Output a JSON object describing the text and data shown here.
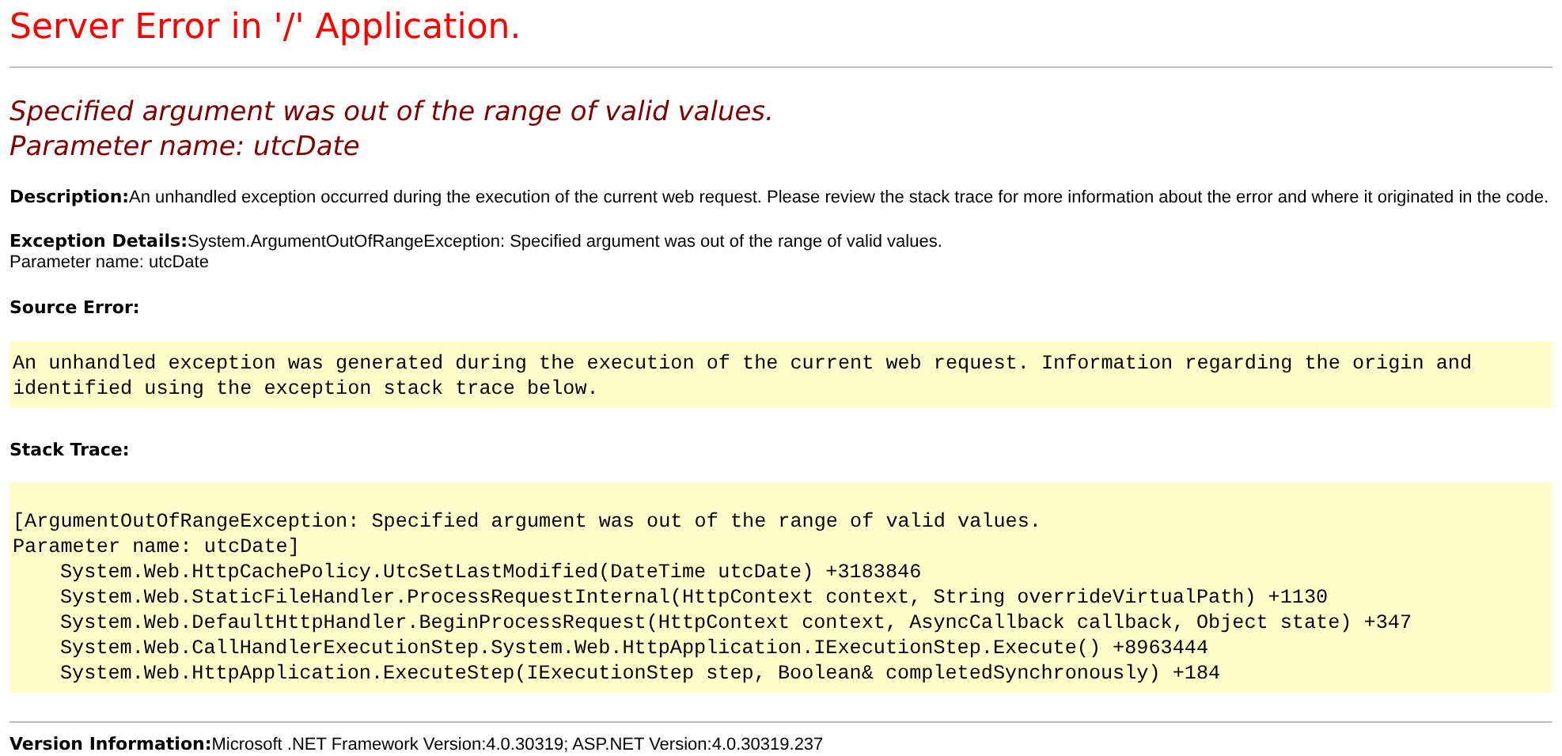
{
  "title": "Server Error in '/' Application.",
  "error_heading": [
    "Specified argument was out of the range of valid values.",
    "Parameter name: utcDate"
  ],
  "description": {
    "label": "Description:",
    "text": "An unhandled exception occurred during the execution of the current web request. Please review the stack trace for more information about the error and where it originated in the code."
  },
  "exception_details": {
    "label": "Exception Details:",
    "text": "System.ArgumentOutOfRangeException: Specified argument was out of the range of valid values.",
    "extra": "Parameter name: utcDate"
  },
  "source_error": {
    "label": "Source Error:",
    "text": "An unhandled exception was generated during the execution of the current web request. Information regarding the origin and identified using the exception stack trace below."
  },
  "stack_trace": {
    "label": "Stack Trace:",
    "lines": [
      {
        "kind": "message",
        "text": "[ArgumentOutOfRangeException: Specified argument was out of the range of valid values."
      },
      {
        "kind": "message",
        "text": "Parameter name: utcDate]"
      },
      {
        "kind": "frame",
        "text": "System.Web.HttpCachePolicy.UtcSetLastModified(DateTime utcDate) +3183846"
      },
      {
        "kind": "frame",
        "text": "System.Web.StaticFileHandler.ProcessRequestInternal(HttpContext context, String overrideVirtualPath) +1130"
      },
      {
        "kind": "frame",
        "text": "System.Web.DefaultHttpHandler.BeginProcessRequest(HttpContext context, AsyncCallback callback, Object state) +347"
      },
      {
        "kind": "frame",
        "text": "System.Web.CallHandlerExecutionStep.System.Web.HttpApplication.IExecutionStep.Execute() +8963444"
      },
      {
        "kind": "frame",
        "text": "System.Web.HttpApplication.ExecuteStep(IExecutionStep step, Boolean& completedSynchronously) +184"
      }
    ]
  },
  "version": {
    "label": "Version Information:",
    "text": "Microsoft .NET Framework Version:4.0.30319; ASP.NET Version:4.0.30319.237"
  }
}
